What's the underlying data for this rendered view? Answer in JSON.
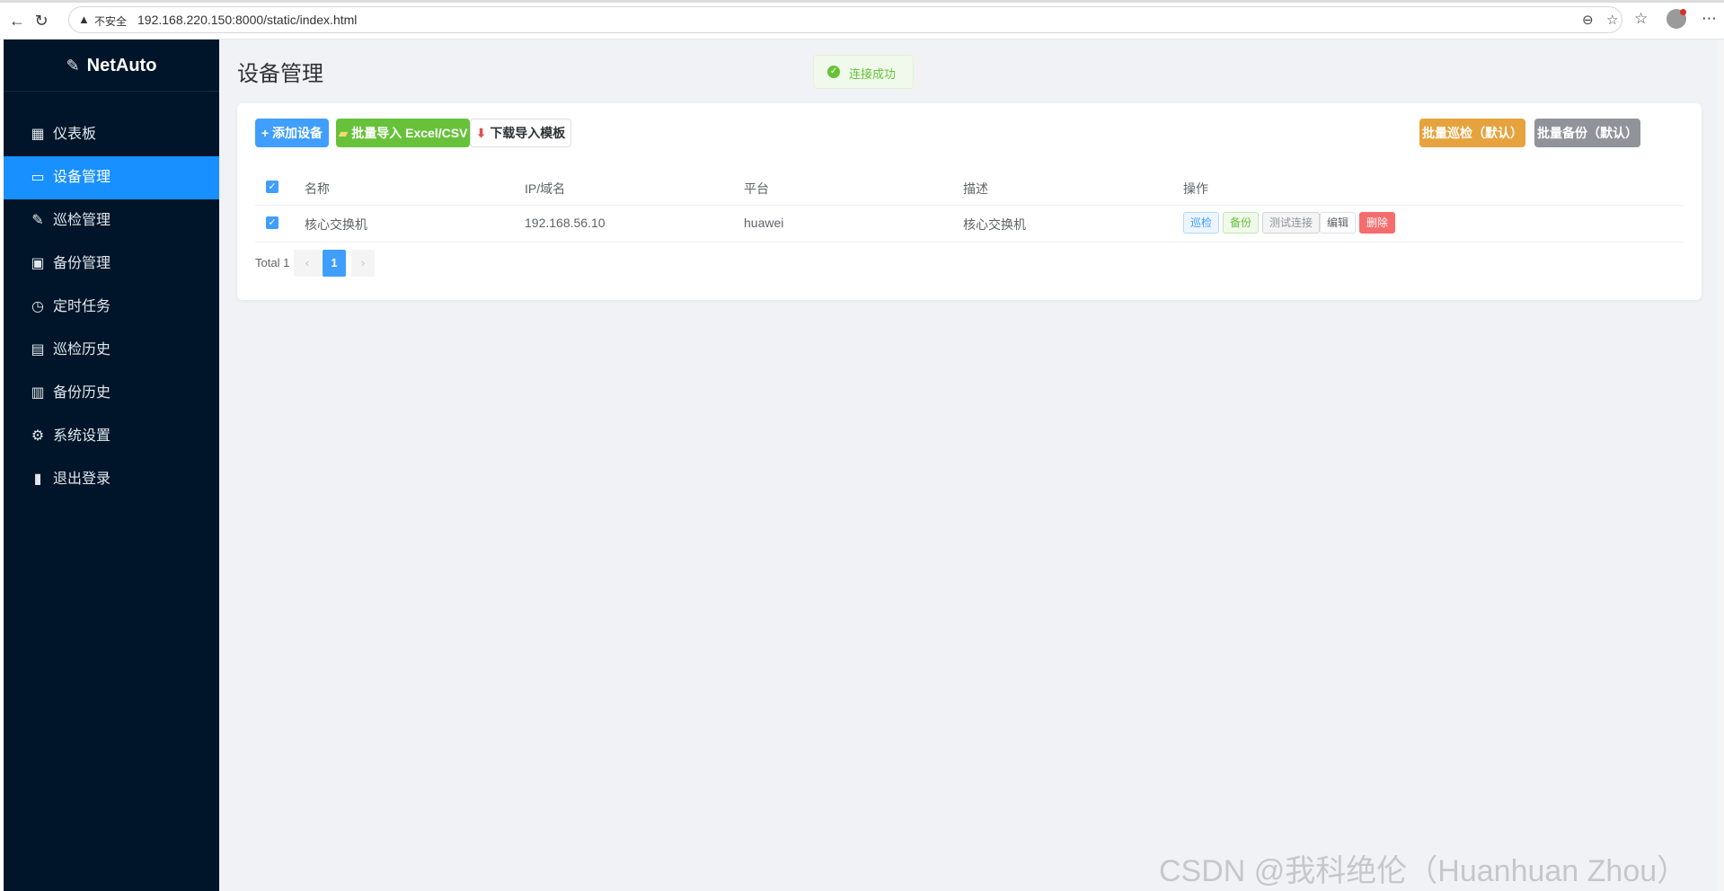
{
  "browser": {
    "warning_label": "不安全",
    "url": "192.168.220.150:8000/static/index.html"
  },
  "sidebar": {
    "logo_text": "NetAuto",
    "items": [
      {
        "label": "仪表板",
        "icon": "dashboard-icon",
        "glyph": "▦"
      },
      {
        "label": "设备管理",
        "icon": "device-icon",
        "glyph": "▭"
      },
      {
        "label": "巡检管理",
        "icon": "wrench-icon",
        "glyph": "✎"
      },
      {
        "label": "备份管理",
        "icon": "floppy-icon",
        "glyph": "▣"
      },
      {
        "label": "定时任务",
        "icon": "alarm-clock-icon",
        "glyph": "◷"
      },
      {
        "label": "巡检历史",
        "icon": "notebook-icon",
        "glyph": "▤"
      },
      {
        "label": "备份历史",
        "icon": "document-icon",
        "glyph": "▥"
      },
      {
        "label": "系统设置",
        "icon": "gear-icon",
        "glyph": "⚙"
      },
      {
        "label": "退出登录",
        "icon": "door-icon",
        "glyph": "▮"
      }
    ],
    "active_index": 1
  },
  "page": {
    "title": "设备管理",
    "toast": "连接成功"
  },
  "toolbar": {
    "add_device": "+ 添加设备",
    "import": "批量导入 Excel/CSV",
    "download_template": "下载导入模板",
    "batch_inspect": "批量巡检（默认）",
    "batch_backup": "批量备份（默认）"
  },
  "table": {
    "columns": [
      "名称",
      "IP/域名",
      "平台",
      "描述",
      "操作"
    ],
    "rows": [
      {
        "name": "核心交换机",
        "ip": "192.168.56.10",
        "platform": "huawei",
        "description": "核心交换机"
      }
    ],
    "actions": {
      "inspect": "巡检",
      "backup": "备份",
      "test": "测试连接",
      "edit": "编辑",
      "delete": "删除"
    }
  },
  "pagination": {
    "total": "Total 1",
    "current": "1"
  },
  "watermark": "CSDN @我科绝伦（Huanhuan Zhou）",
  "colors": {
    "sidebar_bg": "#001529",
    "active": "#1890ff",
    "primary": "#409eff",
    "success": "#67c23a",
    "warning": "#e6a23c",
    "info": "#909399",
    "danger": "#f56c6c"
  }
}
